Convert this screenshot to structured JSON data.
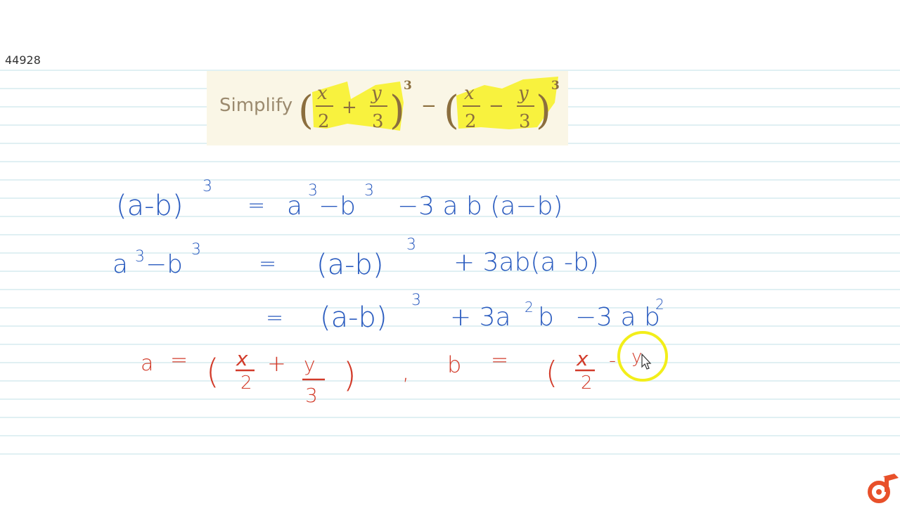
{
  "question_id": "44928",
  "question": {
    "label": "Simplify",
    "expression": "(x/2 + y/3)^3 - (x/2 - y/3)^3",
    "term1": {
      "num1": "x",
      "den1": "2",
      "op": "+",
      "num2": "y",
      "den2": "3",
      "power": "3"
    },
    "between_op": "−",
    "term2": {
      "num1": "x",
      "den1": "2",
      "op": "−",
      "num2": "y",
      "den2": "3",
      "power": "3"
    }
  },
  "handwriting": {
    "ink_blue": "#2a5bbf",
    "ink_red": "#d23b2a",
    "lines": [
      {
        "lhs": "(a-b)^3",
        "rhs": "a^3 - b^3 - 3ab(a-b)"
      },
      {
        "lhs": "a^3 - b^3",
        "rhs": "(a-b)^3 + 3ab(a-b)"
      },
      {
        "lhs": "",
        "rhs": "(a-b)^3 + 3a^2b - 3ab^2"
      },
      {
        "lhs": "a = (x/2 + y/3) , b = (x/2 - y",
        "rhs": ""
      }
    ]
  },
  "text": {
    "l1_lhs_paren": "(a-b)",
    "l1_lhs_pow": "3",
    "l1_eq": "=",
    "l1_a": "a",
    "l1_a_pow": "3",
    "l1_minus_b": "−b",
    "l1_b_pow": "3",
    "l1_rest": "−3 a b (a−b)",
    "l2_a": "a",
    "l2_a_pow": "3",
    "l2_minus_b": "−b",
    "l2_b_pow": "3",
    "l2_eq": "=",
    "l2_paren": "(a-b)",
    "l2_pow": "3",
    "l2_rest": "+ 3ab(a -b)",
    "l3_eq": "=",
    "l3_paren": "(a-b)",
    "l3_pow": "3",
    "l3_plus": "+ 3a",
    "l3_sq": "2",
    "l3_b": "b",
    "l3_minus": "−3 a b",
    "l3_sq2": "2",
    "l4_a": "a",
    "l4_eq": "=",
    "l4_open": "(",
    "l4_x": "x",
    "l4_2": "2",
    "l4_plus": "+",
    "l4_y": "y",
    "l4_3": "3",
    "l4_close": ")",
    "l4_comma": ",",
    "l4_b": "b",
    "l4_eq2": "=",
    "l4_open2": "(",
    "l4_x2": "x",
    "l4_22": "2",
    "l4_minus": "-",
    "l4_y2": "y"
  },
  "cursor": {
    "highlight_color": "#f2ee1a"
  },
  "logo": {
    "name": "doubtnut-logo",
    "color": "#e8502a"
  }
}
